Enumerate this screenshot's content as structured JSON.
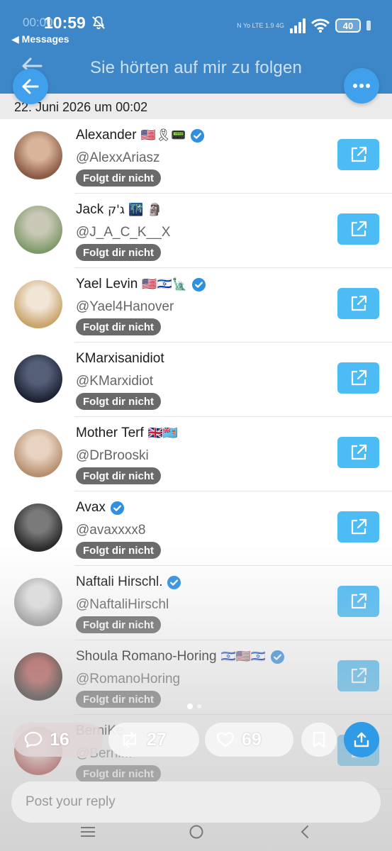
{
  "status_bar": {
    "time_ghost": "00:00",
    "time": "10:59",
    "back_app": "Messages",
    "network_small": "N  Yo LTE  1.9 4G",
    "battery": "40"
  },
  "header": {
    "title": "Sie hörten auf mir zu folgen",
    "date": "22. Juni 2026 um 00:02"
  },
  "badge_label": "Folgt dir nicht",
  "accounts": [
    {
      "name": "Alexander",
      "emoji": "🇺🇸🎗📟",
      "verified": true,
      "handle": "@AlexxAriasz",
      "avatar_colors": [
        "#8a5a44",
        "#d9b49a"
      ]
    },
    {
      "name": "Jack",
      "emoji": "ג'ק 🌃 🗿",
      "verified": false,
      "handle": "@J_A_C_K__X",
      "avatar_colors": [
        "#7f9a6a",
        "#c9c7b5"
      ]
    },
    {
      "name": "Yael Levin",
      "emoji": "🇺🇸🇮🇱🗽",
      "verified": true,
      "handle": "@Yael4Hanover",
      "avatar_colors": [
        "#c9a36a",
        "#f1e6d6"
      ]
    },
    {
      "name": "KMarxisanidiot",
      "emoji": "",
      "verified": false,
      "handle": "@KMarxidiot",
      "avatar_colors": [
        "#1c2233",
        "#556078"
      ]
    },
    {
      "name": "Mother Terf",
      "emoji": "🇬🇧🇫🇯",
      "verified": false,
      "handle": "@DrBrooski",
      "avatar_colors": [
        "#b78f6e",
        "#e8d3c2"
      ]
    },
    {
      "name": "Avax",
      "emoji": "",
      "verified": true,
      "handle": "@avaxxxx8",
      "avatar_colors": [
        "#2a2a2a",
        "#7a7a7a"
      ]
    },
    {
      "name": "Naftali Hirschl.",
      "emoji": "",
      "verified": true,
      "handle": "@NaftaliHirschl",
      "avatar_colors": [
        "#9a9a9a",
        "#e0e0e0"
      ]
    },
    {
      "name": "Shoula Romano-Horing",
      "emoji": "🇮🇱🇺🇸🇮🇱",
      "verified": true,
      "handle": "@RomanoHoring",
      "avatar_colors": [
        "#1f1a18",
        "#b0524e"
      ]
    },
    {
      "name": "BerniKe...",
      "emoji": "",
      "verified": false,
      "handle": "@Berni...",
      "avatar_colors": [
        "#a01b1b",
        "#e8b7a7"
      ]
    }
  ],
  "actions": {
    "replies": "16",
    "retweets": "27",
    "likes": "69"
  },
  "reply_placeholder": "Post your reply",
  "colors": {
    "header_bg": "#3d87c8",
    "button_blue": "#4dbbf4",
    "verified_blue": "#2f8fe0",
    "badge_bg": "#6a6a6a"
  }
}
